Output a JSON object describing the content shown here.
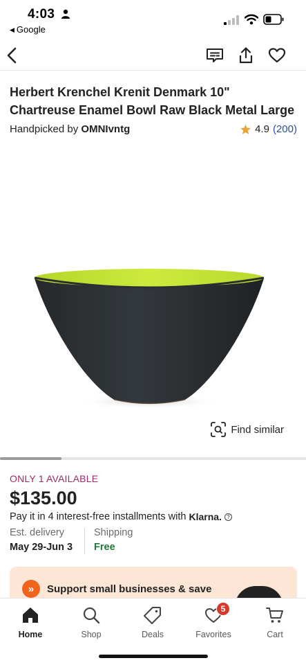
{
  "status_bar": {
    "time": "4:03",
    "back_app": "Google"
  },
  "listing": {
    "title": "Herbert Krenchel Krenit Denmark 10\" Chartreuse Enamel Bowl Raw Black Metal Large",
    "handpicked_prefix": "Handpicked by",
    "shop_name": "OMNIvntg",
    "rating": "4.9",
    "review_count": "(200)",
    "find_similar_label": "Find similar",
    "image_progress": 0.2
  },
  "purchase": {
    "availability": "ONLY 1 AVAILABLE",
    "price": "$135.00",
    "installments_text": "Pay it in 4 interest-free installments with",
    "klarna_label": "Klarna.",
    "delivery_label": "Est. delivery",
    "delivery_value": "May 29-Jun 3",
    "shipping_label": "Shipping",
    "shipping_value": "Free"
  },
  "promo": {
    "text": "Support small businesses & save"
  },
  "tab_bar": {
    "tabs": [
      {
        "label": "Home",
        "icon": "home-icon",
        "active": true
      },
      {
        "label": "Shop",
        "icon": "search-icon",
        "active": false
      },
      {
        "label": "Deals",
        "icon": "tag-icon",
        "active": false
      },
      {
        "label": "Favorites",
        "icon": "heart-icon",
        "active": false,
        "badge": "5"
      },
      {
        "label": "Cart",
        "icon": "cart-icon",
        "active": false
      }
    ]
  },
  "colors": {
    "availability": "#a1286a",
    "review_link": "#2a4fa0",
    "free_shipping": "#1f7a3b",
    "promo_bg": "#fde6d5",
    "promo_badge": "#f1641e",
    "badge_red": "#d5392a",
    "bowl_interior": "#c6e633",
    "bowl_exterior": "#2b2f33"
  }
}
